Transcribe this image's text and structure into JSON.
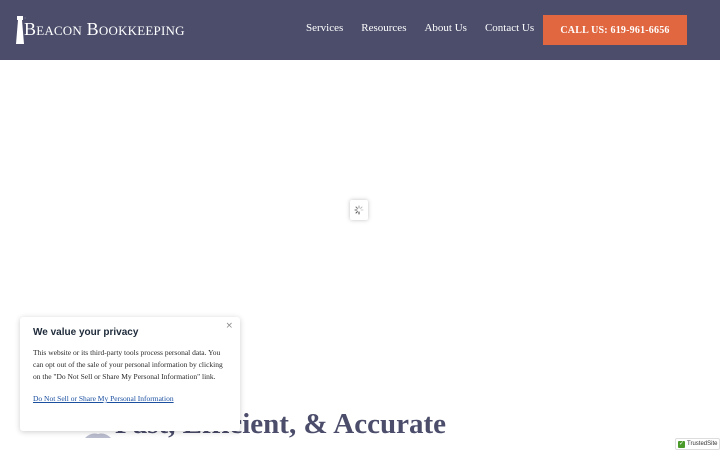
{
  "header": {
    "logo_text": "Beacon Bookkeeping",
    "nav": [
      "Services",
      "Resources",
      "About Us",
      "Contact Us"
    ],
    "cta_label": "CALL US: 619-961-6656"
  },
  "hero": {
    "title": "Fast, Efficient, & Accurate"
  },
  "cookie_banner": {
    "title": "We value your privacy",
    "body": "This website or its third-party tools process personal data. You can opt out of the sale of your personal information by clicking on the \"Do Not Sell or Share My Personal Information\" link.",
    "link": "Do Not Sell or Share My Personal Information",
    "close_symbol": "×"
  },
  "badge": {
    "label": "TrustedSite"
  },
  "colors": {
    "header_bg": "#4b4d6b",
    "cta_bg": "#e0673f",
    "title_color": "#4b4d6b"
  }
}
